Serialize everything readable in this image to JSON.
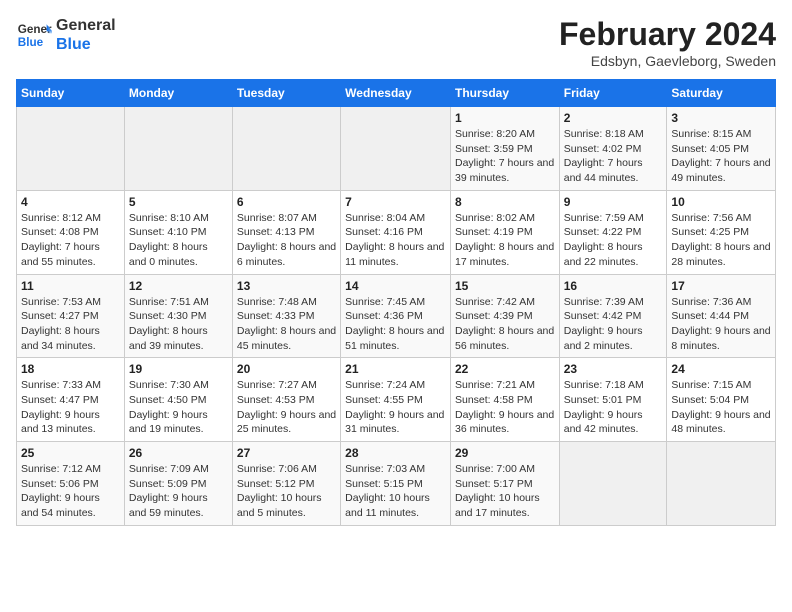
{
  "logo": {
    "line1": "General",
    "line2": "Blue"
  },
  "title": "February 2024",
  "subtitle": "Edsbyn, Gaevleborg, Sweden",
  "days_of_week": [
    "Sunday",
    "Monday",
    "Tuesday",
    "Wednesday",
    "Thursday",
    "Friday",
    "Saturday"
  ],
  "weeks": [
    [
      {
        "day": "",
        "info": ""
      },
      {
        "day": "",
        "info": ""
      },
      {
        "day": "",
        "info": ""
      },
      {
        "day": "",
        "info": ""
      },
      {
        "day": "1",
        "info": "Sunrise: 8:20 AM\nSunset: 3:59 PM\nDaylight: 7 hours and 39 minutes."
      },
      {
        "day": "2",
        "info": "Sunrise: 8:18 AM\nSunset: 4:02 PM\nDaylight: 7 hours and 44 minutes."
      },
      {
        "day": "3",
        "info": "Sunrise: 8:15 AM\nSunset: 4:05 PM\nDaylight: 7 hours and 49 minutes."
      }
    ],
    [
      {
        "day": "4",
        "info": "Sunrise: 8:12 AM\nSunset: 4:08 PM\nDaylight: 7 hours and 55 minutes."
      },
      {
        "day": "5",
        "info": "Sunrise: 8:10 AM\nSunset: 4:10 PM\nDaylight: 8 hours and 0 minutes."
      },
      {
        "day": "6",
        "info": "Sunrise: 8:07 AM\nSunset: 4:13 PM\nDaylight: 8 hours and 6 minutes."
      },
      {
        "day": "7",
        "info": "Sunrise: 8:04 AM\nSunset: 4:16 PM\nDaylight: 8 hours and 11 minutes."
      },
      {
        "day": "8",
        "info": "Sunrise: 8:02 AM\nSunset: 4:19 PM\nDaylight: 8 hours and 17 minutes."
      },
      {
        "day": "9",
        "info": "Sunrise: 7:59 AM\nSunset: 4:22 PM\nDaylight: 8 hours and 22 minutes."
      },
      {
        "day": "10",
        "info": "Sunrise: 7:56 AM\nSunset: 4:25 PM\nDaylight: 8 hours and 28 minutes."
      }
    ],
    [
      {
        "day": "11",
        "info": "Sunrise: 7:53 AM\nSunset: 4:27 PM\nDaylight: 8 hours and 34 minutes."
      },
      {
        "day": "12",
        "info": "Sunrise: 7:51 AM\nSunset: 4:30 PM\nDaylight: 8 hours and 39 minutes."
      },
      {
        "day": "13",
        "info": "Sunrise: 7:48 AM\nSunset: 4:33 PM\nDaylight: 8 hours and 45 minutes."
      },
      {
        "day": "14",
        "info": "Sunrise: 7:45 AM\nSunset: 4:36 PM\nDaylight: 8 hours and 51 minutes."
      },
      {
        "day": "15",
        "info": "Sunrise: 7:42 AM\nSunset: 4:39 PM\nDaylight: 8 hours and 56 minutes."
      },
      {
        "day": "16",
        "info": "Sunrise: 7:39 AM\nSunset: 4:42 PM\nDaylight: 9 hours and 2 minutes."
      },
      {
        "day": "17",
        "info": "Sunrise: 7:36 AM\nSunset: 4:44 PM\nDaylight: 9 hours and 8 minutes."
      }
    ],
    [
      {
        "day": "18",
        "info": "Sunrise: 7:33 AM\nSunset: 4:47 PM\nDaylight: 9 hours and 13 minutes."
      },
      {
        "day": "19",
        "info": "Sunrise: 7:30 AM\nSunset: 4:50 PM\nDaylight: 9 hours and 19 minutes."
      },
      {
        "day": "20",
        "info": "Sunrise: 7:27 AM\nSunset: 4:53 PM\nDaylight: 9 hours and 25 minutes."
      },
      {
        "day": "21",
        "info": "Sunrise: 7:24 AM\nSunset: 4:55 PM\nDaylight: 9 hours and 31 minutes."
      },
      {
        "day": "22",
        "info": "Sunrise: 7:21 AM\nSunset: 4:58 PM\nDaylight: 9 hours and 36 minutes."
      },
      {
        "day": "23",
        "info": "Sunrise: 7:18 AM\nSunset: 5:01 PM\nDaylight: 9 hours and 42 minutes."
      },
      {
        "day": "24",
        "info": "Sunrise: 7:15 AM\nSunset: 5:04 PM\nDaylight: 9 hours and 48 minutes."
      }
    ],
    [
      {
        "day": "25",
        "info": "Sunrise: 7:12 AM\nSunset: 5:06 PM\nDaylight: 9 hours and 54 minutes."
      },
      {
        "day": "26",
        "info": "Sunrise: 7:09 AM\nSunset: 5:09 PM\nDaylight: 9 hours and 59 minutes."
      },
      {
        "day": "27",
        "info": "Sunrise: 7:06 AM\nSunset: 5:12 PM\nDaylight: 10 hours and 5 minutes."
      },
      {
        "day": "28",
        "info": "Sunrise: 7:03 AM\nSunset: 5:15 PM\nDaylight: 10 hours and 11 minutes."
      },
      {
        "day": "29",
        "info": "Sunrise: 7:00 AM\nSunset: 5:17 PM\nDaylight: 10 hours and 17 minutes."
      },
      {
        "day": "",
        "info": ""
      },
      {
        "day": "",
        "info": ""
      }
    ]
  ]
}
